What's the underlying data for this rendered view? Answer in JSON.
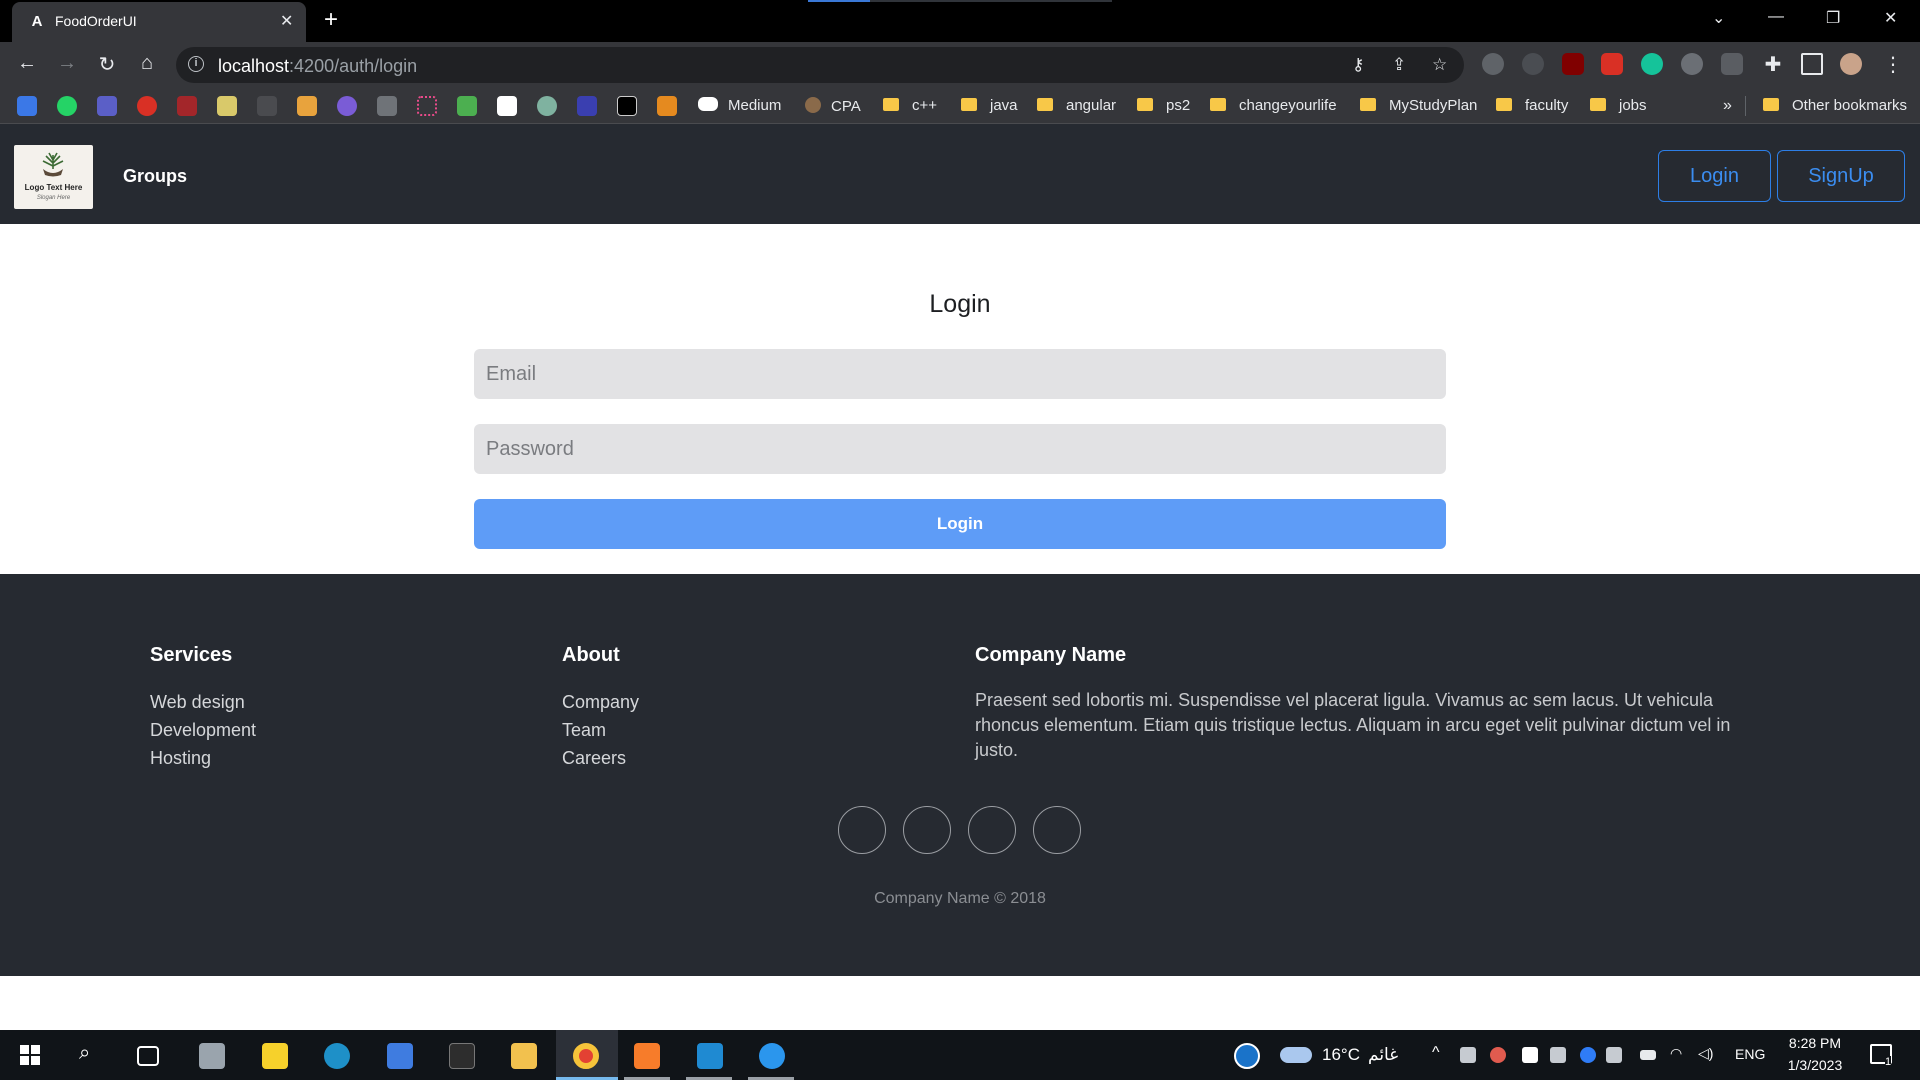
{
  "browser": {
    "tab_title": "FoodOrderUI",
    "tab_favicon": "angular-icon",
    "new_tab_symbol": "+",
    "close_symbol": "✕",
    "url_host": "localhost",
    "url_path": ":4200/auth/login",
    "bookmarks": [
      {
        "label": "Medium",
        "icon": "medium-icon"
      },
      {
        "label": "CPA",
        "icon": "cpa-icon"
      },
      {
        "label": "c++",
        "icon": "folder-icon"
      },
      {
        "label": "java",
        "icon": "folder-icon"
      },
      {
        "label": "angular",
        "icon": "folder-icon"
      },
      {
        "label": "ps2",
        "icon": "folder-icon"
      },
      {
        "label": "changeyourlife",
        "icon": "folder-icon"
      },
      {
        "label": "MyStudyPlan",
        "icon": "folder-icon"
      },
      {
        "label": "faculty",
        "icon": "folder-icon"
      },
      {
        "label": "jobs",
        "icon": "folder-icon"
      }
    ],
    "bookmarks_overflow": "»",
    "other_bookmarks": "Other bookmarks"
  },
  "navbar": {
    "logo_text": "Logo Text Here",
    "logo_subtext": "Slogan Here",
    "groups_link": "Groups",
    "login_button": "Login",
    "signup_button": "SignUp"
  },
  "login": {
    "title": "Login",
    "email_placeholder": "Email",
    "password_placeholder": "Password",
    "submit_label": "Login"
  },
  "footer": {
    "services": {
      "heading": "Services",
      "items": [
        "Web design",
        "Development",
        "Hosting"
      ]
    },
    "about": {
      "heading": "About",
      "items": [
        "Company",
        "Team",
        "Careers"
      ]
    },
    "company": {
      "heading": "Company Name",
      "text": "Praesent sed lobortis mi. Suspendisse vel placerat ligula. Vivamus ac sem lacus. Ut vehicula rhoncus elementum. Etiam quis tristique lectus. Aliquam in arcu eget velit pulvinar dictum vel in justo."
    },
    "copyright": "Company Name © 2018"
  },
  "taskbar": {
    "weather_temp": "16°C",
    "weather_desc": "غائم",
    "language": "ENG",
    "time": "8:28 PM",
    "date": "1/3/2023",
    "notification_count": "1"
  },
  "colors": {
    "navbar_bg": "#262a31",
    "accent_blue": "#3b8df0",
    "login_button": "#5e9cf7",
    "input_bg": "#e2e2e4"
  }
}
